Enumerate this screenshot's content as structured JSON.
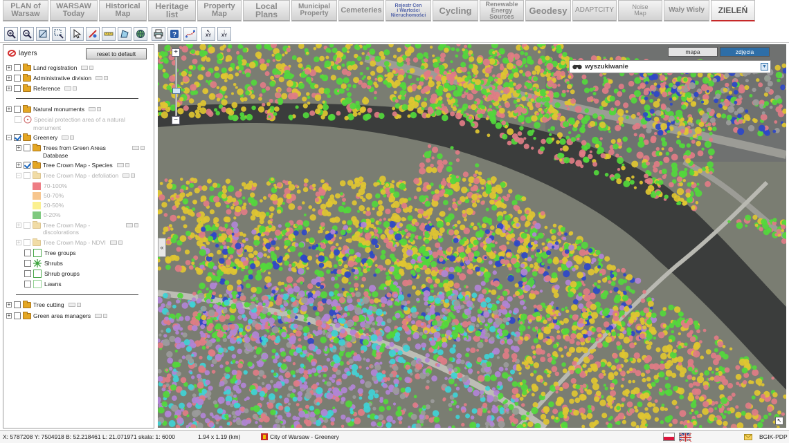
{
  "nav": {
    "tabs": [
      {
        "label": "PLAN of\nWarsaw",
        "w": 66,
        "fs": 11,
        "bold": true
      },
      {
        "label": "WARSAW\nToday",
        "w": 69,
        "fs": 11,
        "bold": true
      },
      {
        "label": "Historical\nMap",
        "w": 69,
        "fs": 11,
        "bold": true
      },
      {
        "label": "Heritage\nlist",
        "w": 69,
        "fs": 12,
        "bold": true
      },
      {
        "label": "Property\nMap",
        "w": 64,
        "fs": 11,
        "bold": true
      },
      {
        "label": "Local\nPlans",
        "w": 68,
        "fs": 12,
        "bold": true
      },
      {
        "label": "Municipal\nProperty",
        "w": 66,
        "fs": 10,
        "bold": true
      },
      {
        "label": "Cemeteries",
        "w": 66,
        "fs": 11,
        "bold": true
      },
      {
        "label": "Rejestr Cen\ni Wartości\nNieruchomości",
        "w": 66,
        "fs": 7,
        "bold": true
      },
      {
        "label": "Cycling",
        "w": 66,
        "fs": 13,
        "bold": true
      },
      {
        "label": "Renewable\nEnergy\nSources",
        "w": 64,
        "fs": 9,
        "bold": true
      },
      {
        "label": "Geodesy",
        "w": 66,
        "fs": 13,
        "bold": true
      },
      {
        "label": "ADAPTCITY",
        "w": 64,
        "fs": 10,
        "bold": false
      },
      {
        "label": "Noise\nMap",
        "w": 64,
        "fs": 9,
        "bold": false
      },
      {
        "label": "Wały Wisły",
        "w": 66,
        "fs": 10,
        "bold": true
      },
      {
        "label": "ZIELEŃ",
        "w": 64,
        "fs": 12,
        "bold": true,
        "active": true
      }
    ]
  },
  "toolbar": {
    "tools": [
      "zoom-in-tool-icon",
      "zoom-out-tool-icon",
      "zoom-extent-icon",
      "zoom-window-icon",
      "select-pointer-icon",
      "feature-info-icon",
      "measure-length-icon",
      "measure-area-icon",
      "globe-icon",
      "print-icon",
      "help-icon",
      "route-icon",
      "xy-coordinate-icon",
      "xy-search-icon"
    ]
  },
  "layers": {
    "title": "layers",
    "reset_label": "reset to default",
    "items": {
      "land": "Land registration",
      "admin": "Administrative division",
      "reference": "Reference",
      "natural": "Natural monuments",
      "special_1": "Special protection area of a natural",
      "special_2": "monument",
      "greenery": "Greenery",
      "trees_db_1": "Trees from Green Areas",
      "trees_db_2": "Database",
      "crown_species": "Tree Crown Map - Species",
      "crown_defol": "Tree Crown Map - defoliation",
      "leg_1": "70-100%",
      "leg_2": "50-70%",
      "leg_3": "20-50%",
      "leg_4": "0-20%",
      "crown_disc_1": "Tree Crown Map -",
      "crown_disc_2": "discolorations",
      "crown_ndvi": "Tree Crown Map - NDVI",
      "tree_groups": "Tree groups",
      "shrubs": "Shrubs",
      "shrub_groups": "Shrub groups",
      "lawns": "Lawns",
      "tree_cutting": "Tree cutting",
      "managers": "Green area managers"
    },
    "legend_colors": [
      "#ee7d84",
      "#f7c68e",
      "#fbf08f",
      "#7fc97f"
    ]
  },
  "map": {
    "basemap": {
      "mapa": "mapa",
      "zdjecia": "zdjęcia"
    },
    "search_label": "wyszukiwanie",
    "colors": {
      "green": "#52d83c",
      "yellow": "#e0c531",
      "pink": "#e07c85",
      "violet": "#b184d6",
      "cyan": "#3fd2d6",
      "blue": "#2d46c9",
      "gray": "#9b9b9b"
    }
  },
  "status": {
    "coords": "X: 5787208 Y: 7504918  B: 52.218461 L: 21.071971  skala: 1: 6000",
    "extent": "1.94 x 1.19 (km)",
    "city": "City of Warsaw - Greenery",
    "brand": "BGIK-PDP"
  }
}
